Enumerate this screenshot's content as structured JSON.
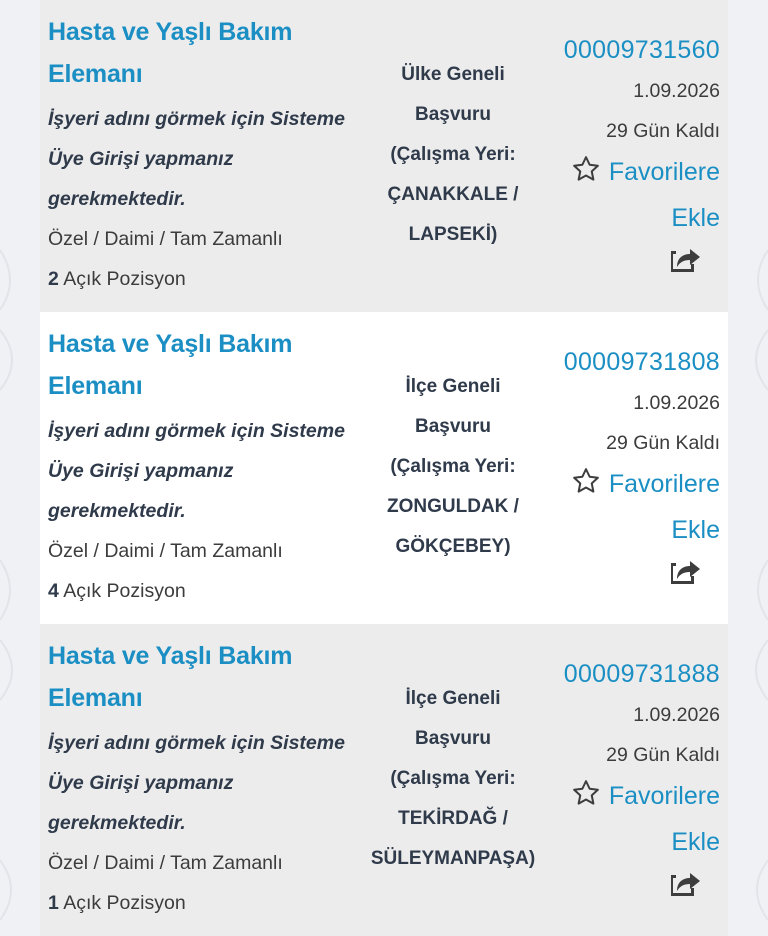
{
  "listings": [
    {
      "title_line1": "Hasta ve Yaşlı Bakım",
      "title_line2": "Elemanı",
      "employer_note_line1": "İşyeri adını görmek için Sisteme",
      "employer_note_line2": "Üye Girişi yapmanız",
      "employer_note_line3": "gerekmektedir.",
      "job_type": "Özel / Daimi / Tam Zamanlı",
      "open_positions": "2",
      "open_positions_label": "Açık Pozisyon",
      "scope_line1": "Ülke Geneli",
      "scope_line2": "Başvuru",
      "location_line1": "(Çalışma Yeri:",
      "location_line2": "ÇANAKKALE /",
      "location_line3": "LAPSEKİ)",
      "listing_number": "00009731560",
      "date": "1.09.2026",
      "days_left": "29 Gün Kaldı",
      "favorite_line1": "Favorilere",
      "favorite_line2": "Ekle"
    },
    {
      "title_line1": "Hasta ve Yaşlı Bakım",
      "title_line2": "Elemanı",
      "employer_note_line1": "İşyeri adını görmek için Sisteme",
      "employer_note_line2": "Üye Girişi yapmanız",
      "employer_note_line3": "gerekmektedir.",
      "job_type": "Özel / Daimi / Tam Zamanlı",
      "open_positions": "4",
      "open_positions_label": "Açık Pozisyon",
      "scope_line1": "İlçe Geneli",
      "scope_line2": "Başvuru",
      "location_line1": "(Çalışma Yeri:",
      "location_line2": "ZONGULDAK /",
      "location_line3": "GÖKÇEBEY)",
      "listing_number": "00009731808",
      "date": "1.09.2026",
      "days_left": "29 Gün Kaldı",
      "favorite_line1": "Favorilere",
      "favorite_line2": "Ekle"
    },
    {
      "title_line1": "Hasta ve Yaşlı Bakım",
      "title_line2": "Elemanı",
      "employer_note_line1": "İşyeri adını görmek için Sisteme",
      "employer_note_line2": "Üye Girişi yapmanız",
      "employer_note_line3": "gerekmektedir.",
      "job_type": "Özel / Daimi / Tam Zamanlı",
      "open_positions": "1",
      "open_positions_label": "Açık Pozisyon",
      "scope_line1": "İlçe Geneli",
      "scope_line2": "Başvuru",
      "location_line1": "(Çalışma Yeri:",
      "location_line2": "TEKİRDAĞ /",
      "location_line3": "SÜLEYMANPAŞA)",
      "listing_number": "00009731888",
      "date": "1.09.2026",
      "days_left": "29 Gün Kaldı",
      "favorite_line1": "Favorilere",
      "favorite_line2": "Ekle"
    }
  ],
  "colors": {
    "title_blue": "#1b8fc4",
    "dark_text": "#2f3a4a",
    "card_gray": "#ececec",
    "card_white": "#ffffff",
    "icon_gray": "#3d3d3d"
  },
  "icons": {
    "favorite": "star-outline-icon",
    "share": "share-arrow-icon"
  }
}
